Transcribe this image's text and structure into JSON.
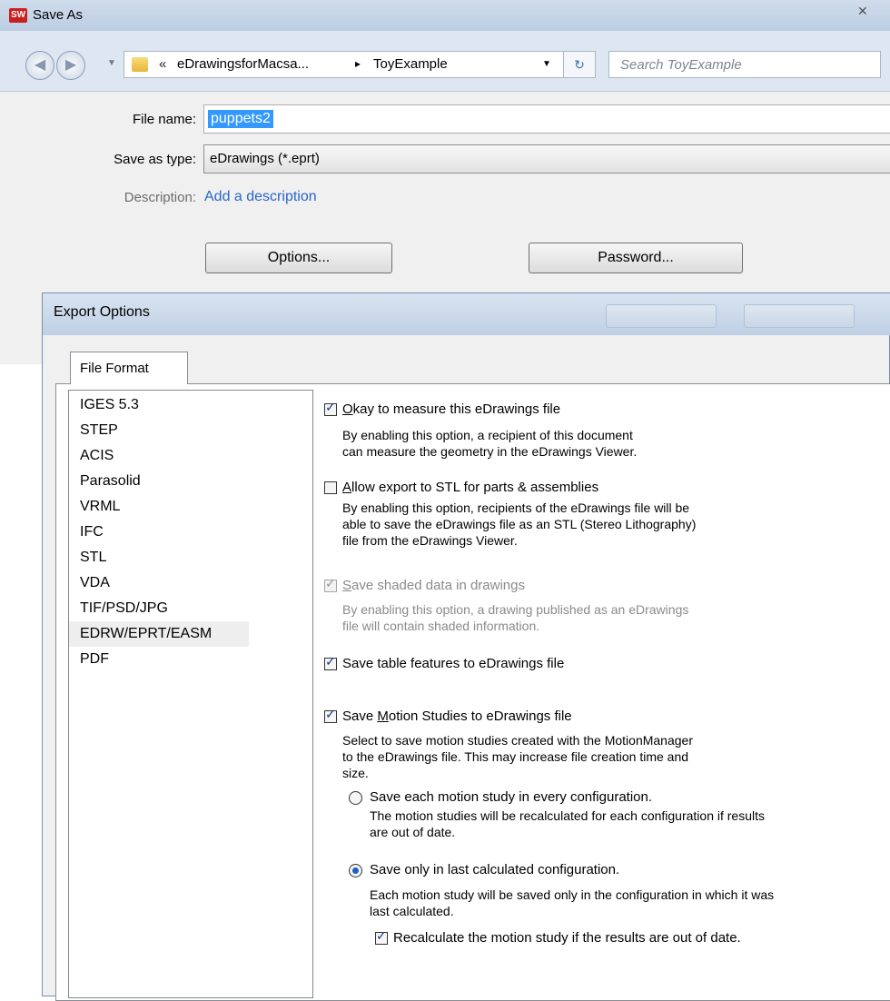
{
  "save_as": {
    "title": "Save As",
    "app_icon_text": "SW",
    "close_glyph": "✕",
    "address": {
      "overflow": "«",
      "parts": [
        "eDrawingsforMacsa...",
        "ToyExample"
      ],
      "separator": "▸"
    },
    "search": {
      "placeholder": "Search ToyExample"
    },
    "labels": {
      "file_name": "File name:",
      "save_as_type": "Save as type:",
      "description": "Description:"
    },
    "file_name": "puppets2",
    "save_as_type": "eDrawings (*.eprt)",
    "description_link": "Add a description",
    "options_button": "Options...",
    "password_button": "Password..."
  },
  "export_options": {
    "title": "Export Options",
    "tab": "File Format",
    "formats": [
      "IGES 5.3",
      "STEP",
      "ACIS",
      "Parasolid",
      "VRML",
      "IFC",
      "STL",
      "VDA",
      "TIF/PSD/JPG",
      "EDRW/EPRT/EASM",
      "PDF"
    ],
    "selected_format": "EDRW/EPRT/EASM",
    "options": {
      "measure": {
        "checked": true,
        "accel": "O",
        "label_rest": "kay to measure this eDrawings file",
        "desc": [
          "By enabling this option, a recipient of this document",
          "can measure the geometry in the eDrawings Viewer."
        ]
      },
      "stl": {
        "checked": false,
        "accel": "A",
        "label_rest": "llow export to STL for parts & assemblies",
        "desc": [
          "By enabling this option, recipients of the eDrawings file will be",
          "able to save the eDrawings file as an STL (Stereo Lithography)",
          "file from the eDrawings Viewer."
        ]
      },
      "shaded": {
        "checked": true,
        "disabled": true,
        "accel": "S",
        "label_rest": "ave shaded data in drawings",
        "desc": [
          "By enabling this option, a drawing published as an eDrawings",
          "file will contain shaded information."
        ]
      },
      "table": {
        "checked": true,
        "label": "Save table features to eDrawings file"
      },
      "motion": {
        "checked": true,
        "label_pre": "Save ",
        "accel": "M",
        "label_rest": "otion Studies to eDrawings file",
        "desc": [
          "Select to save motion studies created with the MotionManager",
          "to the eDrawings file.  This may increase file creation time and",
          "size."
        ]
      },
      "each_config": {
        "selected": false,
        "label": "Save each motion study in every configuration.",
        "desc": [
          "The motion studies will be recalculated for each configuration if results",
          "are out of date."
        ]
      },
      "last_config": {
        "selected": true,
        "label": "Save only in last calculated configuration.",
        "desc": [
          "Each motion study will be saved only in the configuration in which it was",
          "last calculated."
        ]
      },
      "recalc": {
        "checked": true,
        "label": "Recalculate the motion study if the results are out of date."
      }
    }
  },
  "icons": {
    "check": "✓",
    "back": "◀",
    "forward": "▶",
    "dropdown": "▼",
    "refresh": "↻"
  }
}
